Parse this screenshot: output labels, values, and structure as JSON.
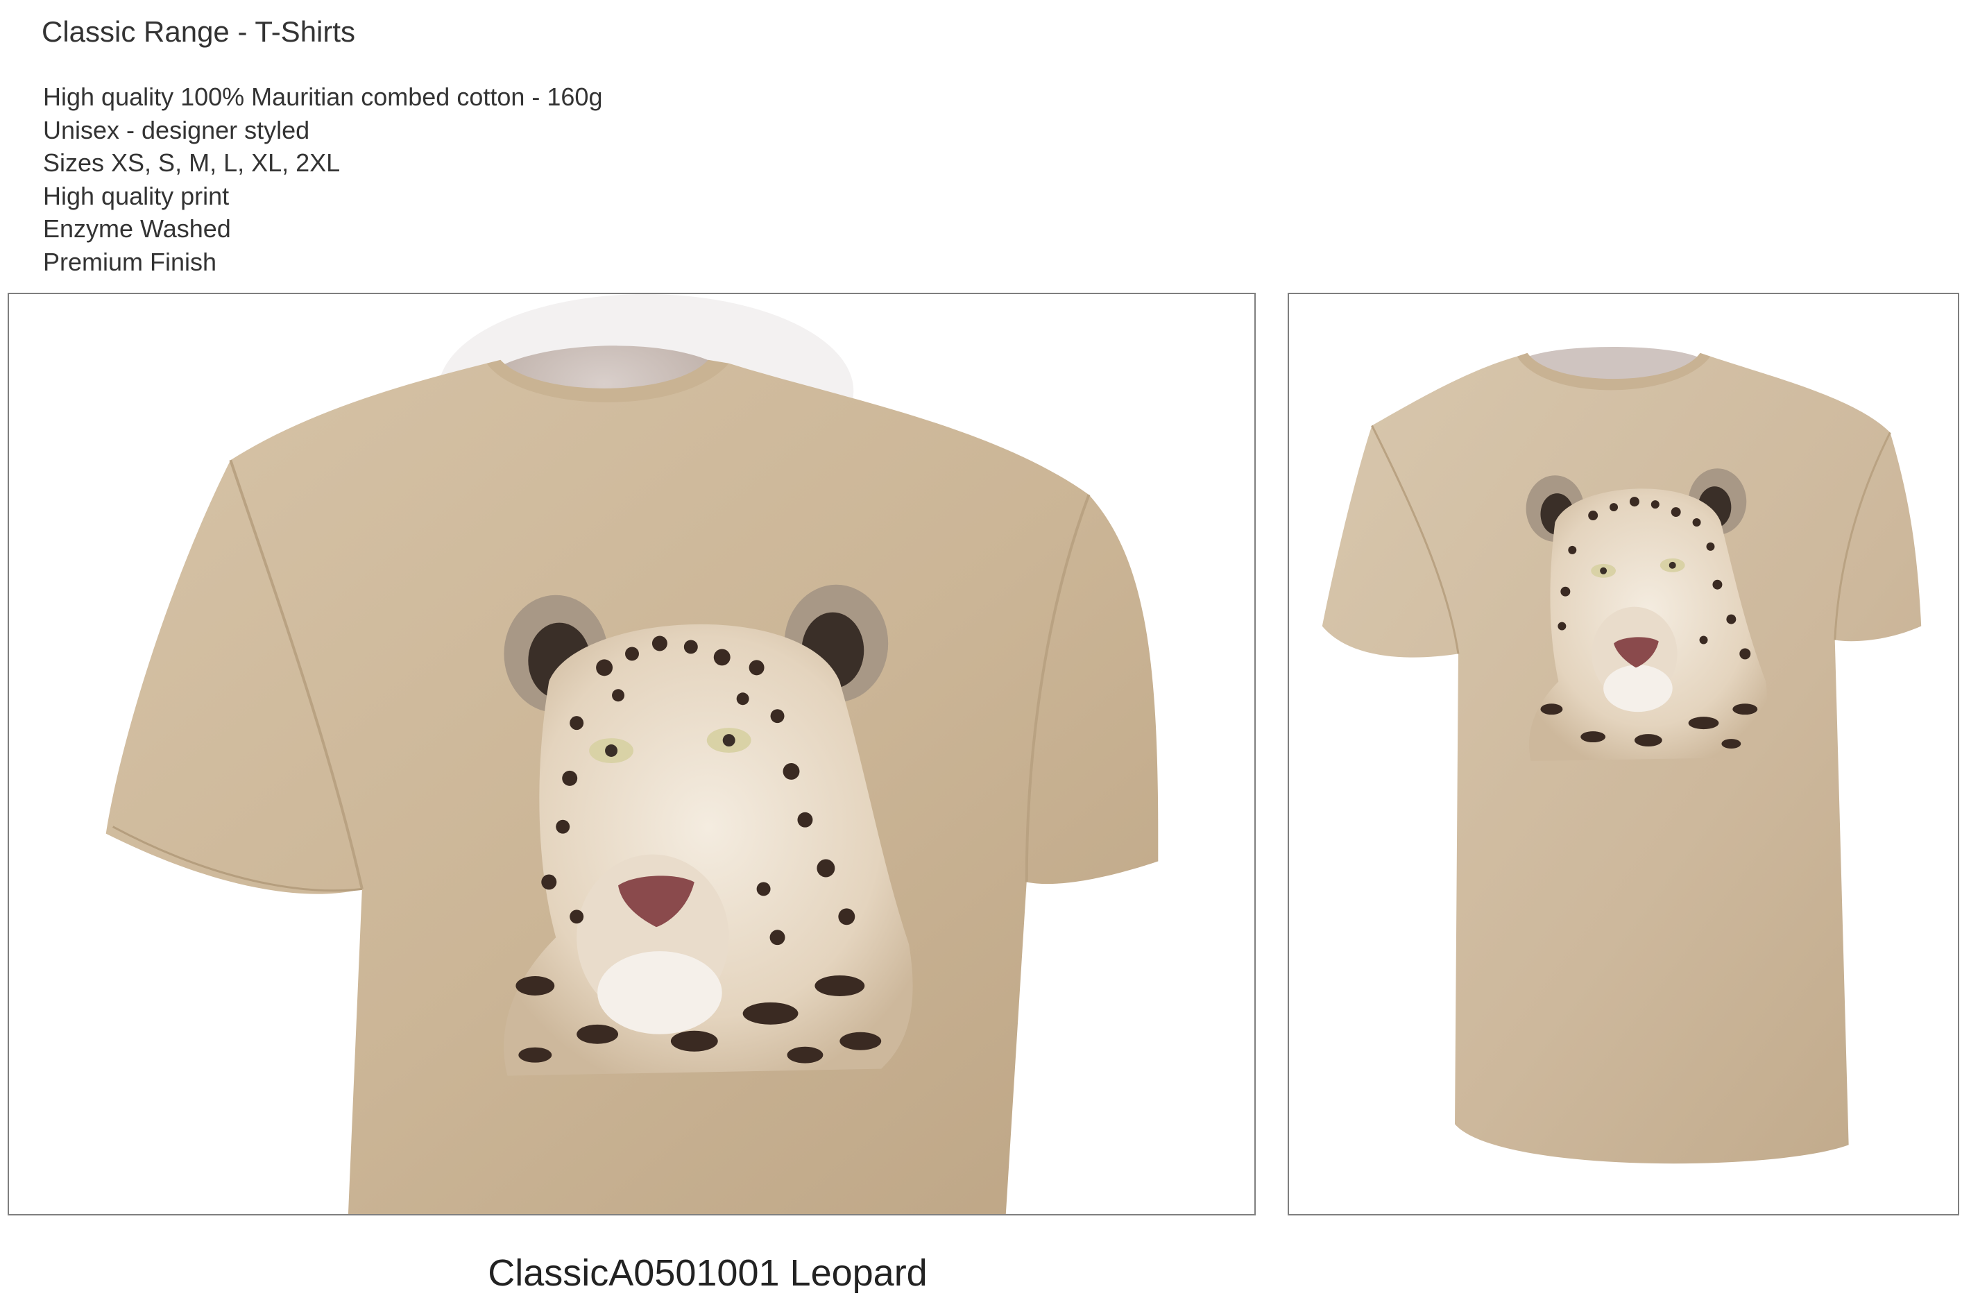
{
  "page": {
    "title": "Classic Range - T-Shirts"
  },
  "features": [
    "High quality 100% Mauritian combed cotton - 160g",
    "Unisex - designer styled",
    "Sizes XS, S, M, L, XL, 2XL",
    "High quality print",
    "Enzyme Washed",
    "Premium Finish"
  ],
  "product": {
    "caption": "ClassicA0501001 Leopard",
    "shirt_color": "#cdb89c",
    "print_subject": "leopard-head-print"
  },
  "panels": [
    {
      "view": "close-up-front",
      "icon": "tshirt-closeup-image"
    },
    {
      "view": "full-front",
      "icon": "tshirt-full-image"
    }
  ]
}
